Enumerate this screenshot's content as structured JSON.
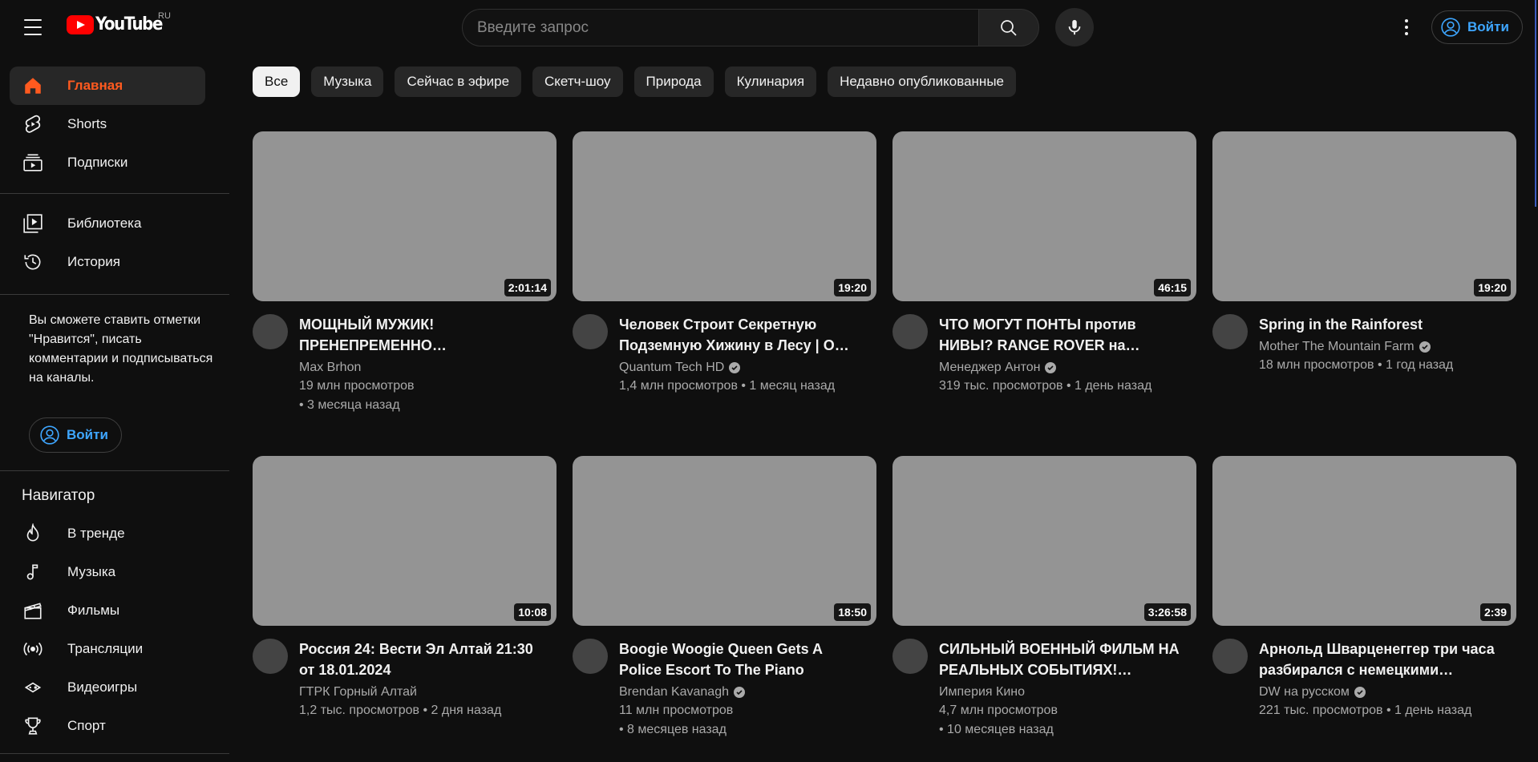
{
  "header": {
    "logo_text": "YouTube",
    "country": "RU",
    "search_placeholder": "Введите запрос",
    "signin_label": "Войти"
  },
  "sidebar": {
    "main": [
      {
        "label": "Главная",
        "icon": "home-icon",
        "active": true
      },
      {
        "label": "Shorts",
        "icon": "shorts-icon"
      },
      {
        "label": "Подписки",
        "icon": "subscriptions-icon"
      }
    ],
    "you": [
      {
        "label": "Библиотека",
        "icon": "library-icon"
      },
      {
        "label": "История",
        "icon": "history-icon"
      }
    ],
    "signin_prompt": "Вы сможете ставить отметки \"Нравится\", писать комментарии и подписываться на каналы.",
    "signin_label": "Войти",
    "explore_title": "Навигатор",
    "explore": [
      {
        "label": "В тренде",
        "icon": "trending-icon"
      },
      {
        "label": "Музыка",
        "icon": "music-icon"
      },
      {
        "label": "Фильмы",
        "icon": "movies-icon"
      },
      {
        "label": "Трансляции",
        "icon": "live-icon"
      },
      {
        "label": "Видеоигры",
        "icon": "gaming-icon"
      },
      {
        "label": "Спорт",
        "icon": "sports-icon"
      }
    ]
  },
  "chips": [
    "Все",
    "Музыка",
    "Сейчас в эфире",
    "Скетч-шоу",
    "Природа",
    "Кулинария",
    "Недавно опубликованные"
  ],
  "videos": [
    {
      "title": "МОЩНЫЙ МУЖИК! ПРЕНЕПРЕМЕННО…",
      "channel": "Max Brhon",
      "verified": false,
      "views": "19 млн просмотров",
      "age": "• 3 месяца назад",
      "duration": "2:01:14"
    },
    {
      "title": "Человек Строит Секретную Подземную Хижину в Лесу | О…",
      "channel": "Quantum Tech HD",
      "verified": true,
      "views": "1,4 млн просмотров • 1 месяц назад",
      "age": "",
      "duration": "19:20"
    },
    {
      "title": "ЧТО МОГУТ ПОНТЫ против НИВЫ? RANGE ROVER на…",
      "channel": "Менеджер Антон",
      "verified": true,
      "views": "319 тыс. просмотров • 1 день назад",
      "age": "",
      "duration": "46:15"
    },
    {
      "title": "Spring in the Rainforest",
      "channel": "Mother The Mountain Farm",
      "verified": true,
      "views": "18 млн просмотров • 1 год назад",
      "age": "",
      "duration": "19:20"
    },
    {
      "title": "Россия 24: Вести Эл Алтай 21:30 от 18.01.2024",
      "channel": "ГТРК Горный Алтай",
      "verified": false,
      "views": "1,2 тыс. просмотров • 2 дня назад",
      "age": "",
      "duration": "10:08"
    },
    {
      "title": "Boogie Woogie Queen Gets A Police Escort To The Piano",
      "channel": "Brendan Kavanagh",
      "verified": true,
      "views": "11 млн просмотров",
      "age": "• 8 месяцев назад",
      "duration": "18:50"
    },
    {
      "title": "СИЛЬНЫЙ ВОЕННЫЙ ФИЛЬМ НА РЕАЛЬНЫХ СОБЫТИЯХ!…",
      "channel": "Империя Кино",
      "verified": false,
      "views": "4,7 млн просмотров",
      "age": "• 10 месяцев назад",
      "duration": "3:26:58"
    },
    {
      "title": "Арнольд Шварценеггер три часа разбирался с немецкими…",
      "channel": "DW на русском",
      "verified": true,
      "views": "221 тыс. просмотров • 1 день назад",
      "age": "",
      "duration": "2:39"
    }
  ]
}
